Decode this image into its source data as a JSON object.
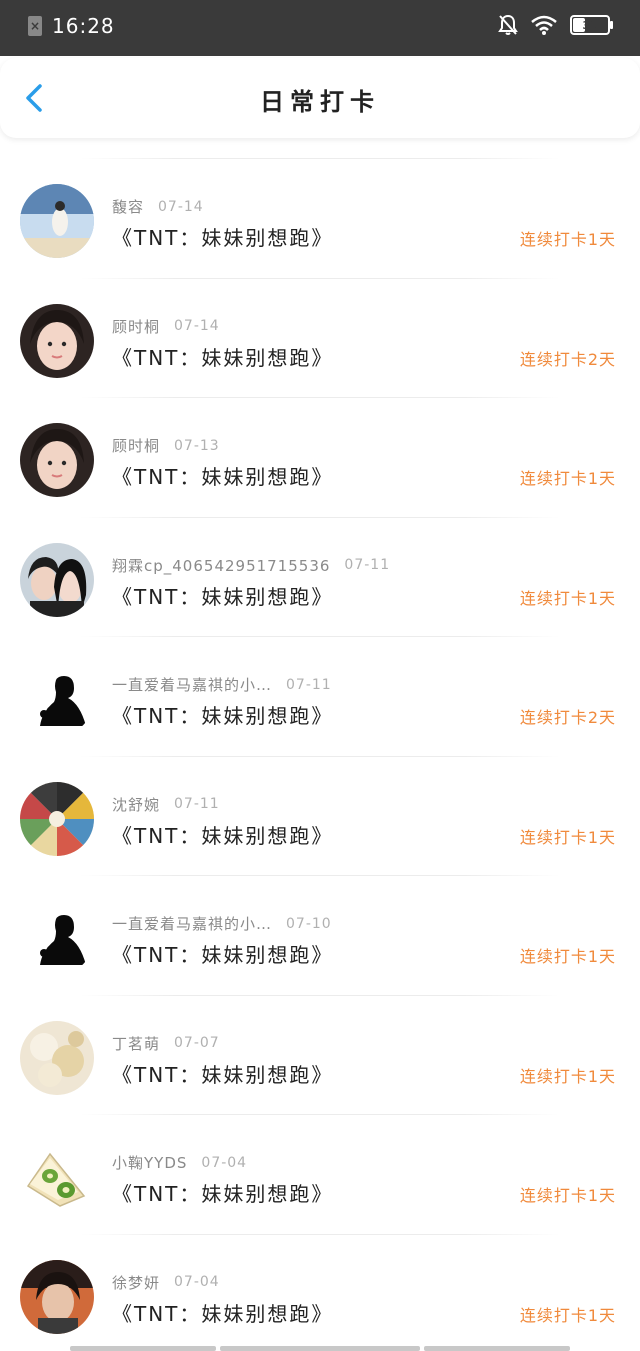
{
  "status_bar": {
    "time": "16:28",
    "battery": "31",
    "icons": [
      "sim-off-icon",
      "notification-off-icon",
      "wifi-icon",
      "battery-icon"
    ]
  },
  "header": {
    "title": "日常打卡",
    "back_icon": "chevron-left-icon",
    "accent_color": "#2a9de9"
  },
  "entries": [
    {
      "username": "馥容",
      "date": "07-14",
      "task": "《TNT：妹妹别想跑》",
      "streak": "连续打卡1天",
      "avatar": "photo"
    },
    {
      "username": "顾时桐",
      "date": "07-14",
      "task": "《TNT：妹妹别想跑》",
      "streak": "连续打卡2天",
      "avatar": "photo"
    },
    {
      "username": "顾时桐",
      "date": "07-13",
      "task": "《TNT：妹妹别想跑》",
      "streak": "连续打卡1天",
      "avatar": "photo"
    },
    {
      "username": "翔霖cp_406542951715536",
      "date": "07-11",
      "task": "《TNT：妹妹别想跑》",
      "streak": "连续打卡1天",
      "avatar": "photo"
    },
    {
      "username": "一直爱着马嘉祺的小…",
      "date": "07-11",
      "task": "《TNT：妹妹别想跑》",
      "streak": "连续打卡2天",
      "avatar": "silhouette"
    },
    {
      "username": "沈舒婉",
      "date": "07-11",
      "task": "《TNT：妹妹别想跑》",
      "streak": "连续打卡1天",
      "avatar": "collage"
    },
    {
      "username": "一直爱着马嘉祺的小…",
      "date": "07-10",
      "task": "《TNT：妹妹别想跑》",
      "streak": "连续打卡1天",
      "avatar": "silhouette"
    },
    {
      "username": "丁茗萌",
      "date": "07-07",
      "task": "《TNT：妹妹别想跑》",
      "streak": "连续打卡1天",
      "avatar": "bokeh"
    },
    {
      "username": "小鞠YYDS",
      "date": "07-04",
      "task": "《TNT：妹妹别想跑》",
      "streak": "连续打卡1天",
      "avatar": "sandwich"
    },
    {
      "username": "徐梦妍",
      "date": "07-04",
      "task": "《TNT：妹妹别想跑》",
      "streak": "连续打卡1天",
      "avatar": "photo"
    }
  ],
  "colors": {
    "streak": "#f08a3c",
    "status_bar_bg": "#3a3a3a"
  }
}
